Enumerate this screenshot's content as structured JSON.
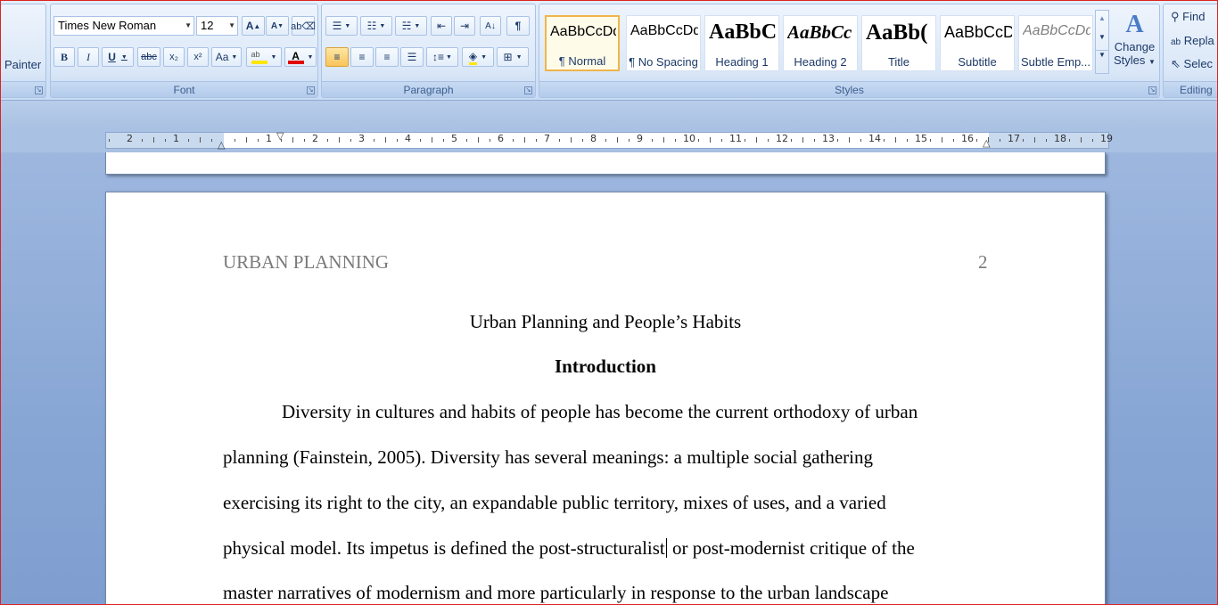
{
  "ribbon": {
    "clipboard": {
      "painter_label": "Painter"
    },
    "font": {
      "group_label": "Font",
      "font_name": "Times New Roman",
      "font_size": "12",
      "bold": "B",
      "italic": "I",
      "underline": "U",
      "strike": "abc",
      "subscript": "x₂",
      "superscript": "x²",
      "change_case": "Aa",
      "grow": "A",
      "shrink": "A"
    },
    "paragraph": {
      "group_label": "Paragraph",
      "pilcrow": "¶"
    },
    "styles": {
      "group_label": "Styles",
      "tiles": [
        {
          "sample": "AaBbCcDd",
          "name": "¶ Normal"
        },
        {
          "sample": "AaBbCcDd",
          "name": "¶ No Spacing"
        },
        {
          "sample": "AaBbC",
          "name": "Heading 1"
        },
        {
          "sample": "AaBbCc",
          "name": "Heading 2"
        },
        {
          "sample": "AaBb(",
          "name": "Title"
        },
        {
          "sample": "AaBbCcD",
          "name": "Subtitle"
        },
        {
          "sample": "AaBbCcDd",
          "name": "Subtle Emp..."
        }
      ],
      "change_styles_line1": "Change",
      "change_styles_line2": "Styles"
    },
    "editing": {
      "group_label": "Editing",
      "find": "Find",
      "replace": "Repla",
      "select": "Selec"
    }
  },
  "ruler": {
    "labels": [
      "2",
      "1",
      "",
      "1",
      "2",
      "3",
      "4",
      "5",
      "6",
      "7",
      "8",
      "9",
      "10",
      "11",
      "12",
      "13",
      "14",
      "15",
      "16",
      "17",
      "18",
      "19"
    ]
  },
  "document": {
    "running_head": "URBAN PLANNING",
    "page_number": "2",
    "title": "Urban Planning and People’s Habits",
    "heading": "Introduction",
    "lines": [
      "Diversity in cultures and habits of people has become the current orthodoxy of urban",
      "planning (Fainstein, 2005). Diversity has several meanings: a multiple social gathering",
      "exercising its right to the city, an expandable public territory, mixes of uses, and a varied",
      "physical model. Its impetus is defined the post-structuralist",
      "master narratives of modernism and more particularly in response to the urban landscape"
    ],
    "line4_after_caret": " or post-modernist critique of the"
  }
}
